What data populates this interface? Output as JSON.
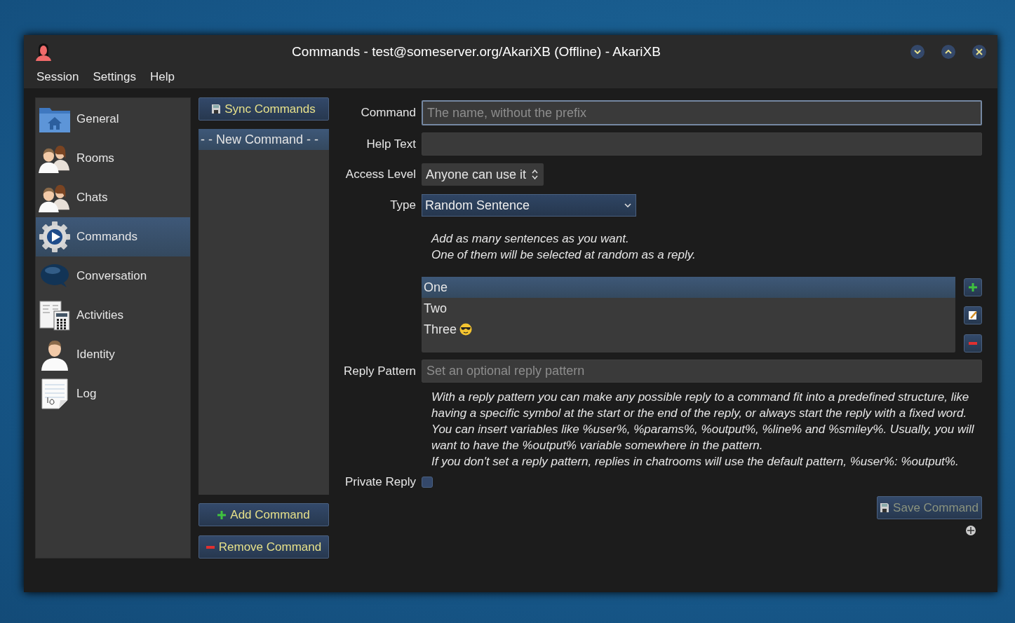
{
  "window": {
    "title": "Commands - test@someserver.org/AkariXB (Offline) - AkariXB"
  },
  "menu": [
    {
      "label": "Session"
    },
    {
      "label": "Settings"
    },
    {
      "label": "Help"
    }
  ],
  "sidebar": {
    "items": [
      {
        "label": "General",
        "selected": false
      },
      {
        "label": "Rooms",
        "selected": false
      },
      {
        "label": "Chats",
        "selected": false
      },
      {
        "label": "Commands",
        "selected": true
      },
      {
        "label": "Conversation",
        "selected": false
      },
      {
        "label": "Activities",
        "selected": false
      },
      {
        "label": "Identity",
        "selected": false
      },
      {
        "label": "Log",
        "selected": false
      }
    ]
  },
  "commands": {
    "sync_button": {
      "label": "Sync Commands"
    },
    "items": [
      {
        "label": "- - New Command - -",
        "selected": true
      }
    ],
    "add_button": {
      "label": "Add Command"
    },
    "remove_button": {
      "label": "Remove Command"
    }
  },
  "form": {
    "command": {
      "label": "Command",
      "placeholder": "The name, without the prefix"
    },
    "help_text": {
      "label": "Help Text"
    },
    "access_level": {
      "label": "Access Level",
      "value": "Anyone can use it"
    },
    "type": {
      "label": "Type",
      "value": "Random Sentence"
    },
    "sentences_hint": [
      "Add as many sentences as you want.",
      "One of them will be selected at random as a reply."
    ],
    "sentences": [
      {
        "text": "One",
        "selected": true,
        "emoji": false
      },
      {
        "text": "Two",
        "selected": false,
        "emoji": false
      },
      {
        "text": "Three",
        "selected": false,
        "emoji": true
      }
    ],
    "reply_pattern": {
      "label": "Reply Pattern",
      "placeholder": "Set an optional reply pattern"
    },
    "reply_pattern_help": [
      "With a reply pattern you can make any possible reply to a command fit into a predefined structure, like having a specific symbol at the start or the end of the reply, or always start the reply with a fixed word.",
      "You can insert variables like %user%, %params%, %output%, %line% and %smiley%. Usually, you will want to have the %output% variable somewhere in the pattern.",
      "If you don't set a reply pattern, replies in chatrooms will use the default pattern, %user%: %output%."
    ],
    "private_reply": {
      "label": "Private Reply",
      "checked": false
    },
    "save_button": {
      "label": "Save Command",
      "disabled": true
    }
  }
}
